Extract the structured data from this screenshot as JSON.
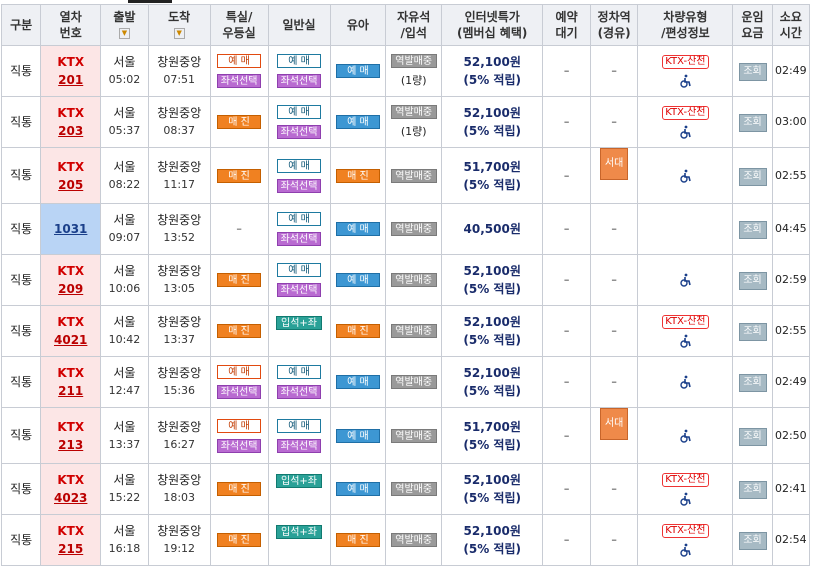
{
  "headers": {
    "kind": "구분",
    "train": [
      "열차",
      "번호"
    ],
    "depart": "출발",
    "arrive": "도착",
    "special": [
      "특실/",
      "우등실"
    ],
    "general": "일반실",
    "infant": "유아",
    "standing": [
      "자유석",
      "/입석"
    ],
    "internet": [
      "인터넷특가",
      "(멤버십 혜택)"
    ],
    "reserve": [
      "예약",
      "대기"
    ],
    "stop": [
      "정차역",
      "(경유)"
    ],
    "vehicle": [
      "차량유형",
      "/편성정보"
    ],
    "fare": [
      "운임",
      "요금"
    ],
    "duration": [
      "소요",
      "시간"
    ],
    "sort_icon": "▼"
  },
  "labels": {
    "reserve": "예 매",
    "seat_select": "좌석선택",
    "sold_out": "매 진",
    "station_sale": "역발매중",
    "standing_plus": "입석+좌석",
    "lookup": "조회",
    "dash": "–",
    "ktx_sancheon": "KTX-산천",
    "seoidae": "서대구"
  },
  "rows": [
    {
      "kind": "직통",
      "name": "KTX",
      "num": "201",
      "dep_sta": "서울",
      "dep_time": "05:02",
      "arr_sta": "창원중앙",
      "arr_time": "07:51",
      "special": "resv",
      "general": "resv",
      "infant": "blue",
      "standing": "역발매중",
      "standing_sub": "(1량)",
      "price": "52,100원",
      "disc": "(5% 적립)",
      "reserve": "–",
      "stop": "–",
      "vehicle": "ktx_icon",
      "duration": "02:49"
    },
    {
      "kind": "직통",
      "name": "KTX",
      "num": "203",
      "dep_sta": "서울",
      "dep_time": "05:37",
      "arr_sta": "창원중앙",
      "arr_time": "08:37",
      "special": "sold",
      "general": "resv",
      "infant": "blue",
      "standing": "역발매중",
      "standing_sub": "(1량)",
      "price": "52,100원",
      "disc": "(5% 적립)",
      "reserve": "–",
      "stop": "–",
      "vehicle": "ktx_icon",
      "duration": "03:00"
    },
    {
      "kind": "직통",
      "name": "KTX",
      "num": "205",
      "dep_sta": "서울",
      "dep_time": "08:22",
      "arr_sta": "창원중앙",
      "arr_time": "11:17",
      "special": "sold",
      "general": "resv",
      "infant": "sold",
      "standing": "역발매중",
      "standing_sub": "",
      "price": "51,700원",
      "disc": "(5% 적립)",
      "reserve": "–",
      "stop": "서대구",
      "vehicle": "icon",
      "duration": "02:55"
    },
    {
      "kind": "직통",
      "name": "",
      "num": "1031",
      "dep_sta": "서울",
      "dep_time": "09:07",
      "arr_sta": "창원중앙",
      "arr_time": "13:52",
      "special": "dash",
      "general": "resv",
      "infant": "blue",
      "standing": "역발매중",
      "standing_sub": "",
      "price": "40,500원",
      "disc": "",
      "reserve": "–",
      "stop": "–",
      "vehicle": "none",
      "duration": "04:45"
    },
    {
      "kind": "직통",
      "name": "KTX",
      "num": "209",
      "dep_sta": "서울",
      "dep_time": "10:06",
      "arr_sta": "창원중앙",
      "arr_time": "13:05",
      "special": "sold",
      "general": "resv",
      "infant": "blue",
      "standing": "역발매중",
      "standing_sub": "",
      "price": "52,100원",
      "disc": "(5% 적립)",
      "reserve": "–",
      "stop": "–",
      "vehicle": "icon",
      "duration": "02:59"
    },
    {
      "kind": "직통",
      "name": "KTX",
      "num": "4021",
      "dep_sta": "서울",
      "dep_time": "10:42",
      "arr_sta": "창원중앙",
      "arr_time": "13:37",
      "special": "sold",
      "general": "standing",
      "infant": "sold",
      "standing": "역발매중",
      "standing_sub": "",
      "price": "52,100원",
      "disc": "(5% 적립)",
      "reserve": "–",
      "stop": "–",
      "vehicle": "ktx_icon",
      "duration": "02:55"
    },
    {
      "kind": "직통",
      "name": "KTX",
      "num": "211",
      "dep_sta": "서울",
      "dep_time": "12:47",
      "arr_sta": "창원중앙",
      "arr_time": "15:36",
      "special": "resv",
      "general": "resv",
      "infant": "blue",
      "standing": "역발매중",
      "standing_sub": "",
      "price": "52,100원",
      "disc": "(5% 적립)",
      "reserve": "–",
      "stop": "–",
      "vehicle": "icon",
      "duration": "02:49"
    },
    {
      "kind": "직통",
      "name": "KTX",
      "num": "213",
      "dep_sta": "서울",
      "dep_time": "13:37",
      "arr_sta": "창원중앙",
      "arr_time": "16:27",
      "special": "resv",
      "general": "resv",
      "infant": "blue",
      "standing": "역발매중",
      "standing_sub": "",
      "price": "51,700원",
      "disc": "(5% 적립)",
      "reserve": "–",
      "stop": "서대구",
      "vehicle": "icon",
      "duration": "02:50"
    },
    {
      "kind": "직통",
      "name": "KTX",
      "num": "4023",
      "dep_sta": "서울",
      "dep_time": "15:22",
      "arr_sta": "창원중앙",
      "arr_time": "18:03",
      "special": "sold",
      "general": "standing",
      "infant": "blue",
      "standing": "역발매중",
      "standing_sub": "",
      "price": "52,100원",
      "disc": "(5% 적립)",
      "reserve": "–",
      "stop": "–",
      "vehicle": "ktx_icon",
      "duration": "02:41"
    },
    {
      "kind": "직통",
      "name": "KTX",
      "num": "215",
      "dep_sta": "서울",
      "dep_time": "16:18",
      "arr_sta": "창원중앙",
      "arr_time": "19:12",
      "special": "sold",
      "general": "standing",
      "infant": "sold",
      "standing": "역발매중",
      "standing_sub": "",
      "price": "52,100원",
      "disc": "(5% 적립)",
      "reserve": "–",
      "stop": "–",
      "vehicle": "ktx_icon",
      "duration": "02:54"
    }
  ]
}
